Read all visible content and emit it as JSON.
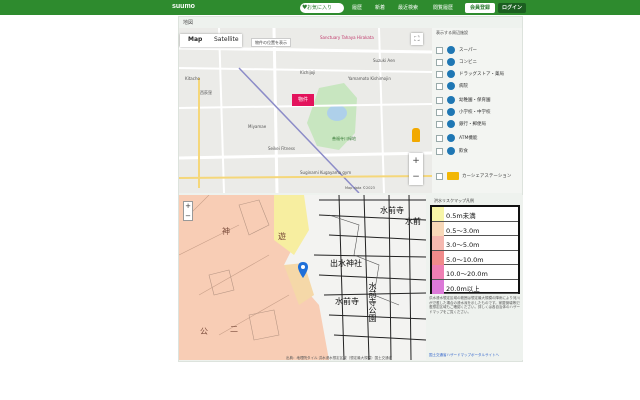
{
  "header": {
    "logo": "suumo",
    "favorites": "お気に入り",
    "nav": [
      "履歴",
      "新着",
      "最近検索",
      "閲覧履歴"
    ],
    "register": "会員登録",
    "login": "ログイン",
    "bar_color": "#2e8b2e"
  },
  "panel": {
    "title": "地図"
  },
  "map": {
    "tabs": [
      "Map",
      "Satellite"
    ],
    "info_box": "物件の位置を表示",
    "pin_label": "物件",
    "labels": {
      "hotel": "Sanctuary Tahaya Hirakata",
      "kichijoji_park": "Kichijoji",
      "nishi": "西荻窪",
      "suzuki": "Suzuki Aen",
      "temple": "Yamamoto Kishimojin",
      "park2": "善福寺川緑地",
      "seika": "Seikei Fitness",
      "gym": "Suginami Kugayama gym",
      "kitacho": "Kitacho",
      "miyamae": "Miyamae"
    },
    "copyright": "Map data ©2023"
  },
  "facilities": {
    "title": "表示する周辺施設",
    "items": [
      {
        "label": "スーパー",
        "icon": "cart-icon",
        "color": "#1f77b4"
      },
      {
        "label": "コンビニ",
        "icon": "store-icon",
        "color": "#1f77b4"
      },
      {
        "label": "ドラッグストア・薬局",
        "icon": "pill-icon",
        "color": "#1f77b4"
      },
      {
        "label": "病院",
        "icon": "hospital-icon",
        "color": "#1f77b4"
      },
      {
        "label": "幼稚園・保育園",
        "icon": "child-icon",
        "color": "#1f77b4"
      },
      {
        "label": "小学校・中学校",
        "icon": "school-icon",
        "color": "#1f77b4"
      },
      {
        "label": "銀行・郵便局",
        "icon": "bank-icon",
        "color": "#1f77b4"
      },
      {
        "label": "ATM機能",
        "icon": "atm-icon",
        "color": "#1f77b4"
      },
      {
        "label": "飲食",
        "icon": "food-icon",
        "color": "#1f77b4"
      },
      {
        "label": "カーシェアステーション",
        "icon": "car-icon",
        "color": "#f2b705"
      }
    ]
  },
  "hazard_map": {
    "labels": {
      "a": "水前寺",
      "b": "水前",
      "c": "出水神社",
      "d": "水前寺公園",
      "e": "水前寺",
      "f": "遊",
      "g": "二",
      "h": "神",
      "i": "公"
    }
  },
  "hazard": {
    "title": "洪水リスクマップ凡例",
    "legend": [
      {
        "label": "0.5m未満",
        "color": "#f7f5a8"
      },
      {
        "label": "0.5〜3.0m",
        "color": "#f8d8b8"
      },
      {
        "label": "3.0〜5.0m",
        "color": "#f5b8b0"
      },
      {
        "label": "5.0〜10.0m",
        "color": "#f08b8b"
      },
      {
        "label": "10.0〜20.0m",
        "color": "#ef7fb3"
      },
      {
        "label": "20.0m以上",
        "color": "#dc7ad8"
      }
    ],
    "note": "洪水浸水想定区域の範囲は想定最大規模の降雨により河川が氾濫した場合の浸水深を示したものです。家屋倒壊等氾濫想定区域もご確認ください。詳しくは各自治体のハザードマップをご覧ください。",
    "link": "国土交通省ハザードマップポータルサイトへ",
    "attribution": "出典：地理院タイル 洪水浸水想定区域（想定最大規模）国土交通省"
  }
}
